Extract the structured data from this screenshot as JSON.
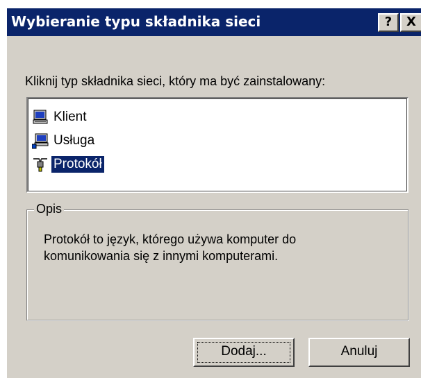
{
  "window": {
    "title": "Wybieranie typu składnika sieci",
    "help_label": "?",
    "close_label": "X"
  },
  "prompt": "Kliknij typ składnika sieci, który ma być zainstalowany:",
  "list": {
    "items": [
      {
        "label": "Klient",
        "icon": "computer-icon",
        "selected": false
      },
      {
        "label": "Usługa",
        "icon": "service-icon",
        "selected": false
      },
      {
        "label": "Protokół",
        "icon": "protocol-cable-icon",
        "selected": true
      }
    ]
  },
  "description_group": {
    "legend": "Opis",
    "text_line1": "Protokół to język, którego używa komputer do",
    "text_line2": "komunikowania się z innymi komputerami."
  },
  "buttons": {
    "add_label": "Dodaj...",
    "cancel_label": "Anuluj"
  },
  "colors": {
    "face": "#d4d0c8",
    "titlebar": "#0a246a",
    "selection": "#0a246a"
  }
}
